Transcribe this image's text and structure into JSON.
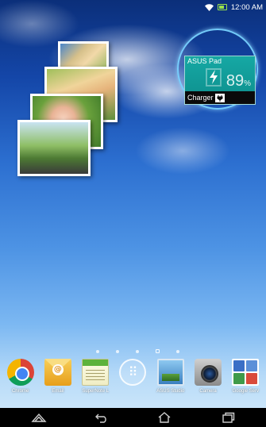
{
  "status_bar": {
    "time": "12:00 AM"
  },
  "battery_widget": {
    "device_name": "ASUS Pad",
    "percent": "89",
    "percent_sign": "%",
    "charger_label": "Charger"
  },
  "page_indicator": {
    "dots": [
      "",
      "",
      "",
      "home",
      ""
    ]
  },
  "dock": {
    "items": [
      {
        "label": "Chrome",
        "icon": "chrome-icon"
      },
      {
        "label": "Email",
        "icon": "email-icon"
      },
      {
        "label": "SuperNote L",
        "icon": "supernote-icon"
      },
      {
        "label": "",
        "icon": "all-apps-icon"
      },
      {
        "label": "ASUS Studio",
        "icon": "asus-studio-icon"
      },
      {
        "label": "Camera",
        "icon": "camera-icon"
      },
      {
        "label": "Google Serv",
        "icon": "google-services-icon"
      }
    ]
  },
  "nav_bar": {
    "buttons": [
      "home-shortcut-icon",
      "back-icon",
      "home-icon",
      "recent-apps-icon"
    ]
  },
  "colors": {
    "battery_card": "#0d8e8c",
    "widget_ring": "#78d2ff",
    "status_battery": "#9ae34b"
  }
}
